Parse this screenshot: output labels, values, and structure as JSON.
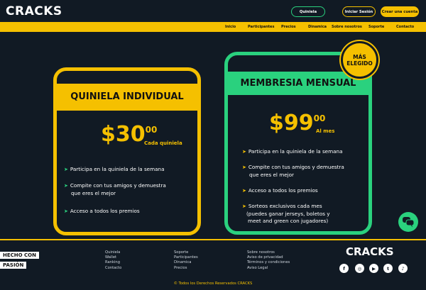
{
  "header": {
    "logo": "CRACKS",
    "buttons": {
      "quiniela": "Quiniela",
      "login": "Iniciar Sesión",
      "signup": "Crear una cuenta"
    },
    "nav": [
      "Inicio",
      "Participantes",
      "Precios",
      "Dinamica",
      "Sobre nosotros",
      "Soporte",
      "Contacto"
    ]
  },
  "plans": {
    "individual": {
      "title": "QUINIELA INDIVIDUAL",
      "price": "$30",
      "cents": "00",
      "period": "Cada quiniela",
      "features": [
        "Participa en la quiniela de la semana",
        "Compite con tus amigos y demuestra",
        "que eres el mejor",
        "Acceso a todos los premios"
      ]
    },
    "membership": {
      "badge_line1": "MÁS",
      "badge_line2": "ELEGIDO",
      "title": "MEMBRESIA MENSUAL",
      "price": "$99",
      "cents": "00",
      "period": "Al mes",
      "features": [
        "Participa en la quiniela de la semana",
        "Compite con tus amigos y demuestra",
        "que eres el mejor",
        "Acceso a todos los premios",
        "Sorteos exclusivos cada mes",
        "(puedes ganar jerseys, boletos y",
        "meet and green con jugadores)"
      ]
    }
  },
  "footer": {
    "hecho_line1": "HECHO CON",
    "hecho_line2": "PASIÓN",
    "col1": [
      "Quiniela",
      "Wallet",
      "Ranking",
      "Contacto"
    ],
    "col2": [
      "Soporte",
      "Participantes",
      "Dinamica",
      "Precios"
    ],
    "col3": [
      "Sobre nosotros",
      "Aviso de privacidad",
      "Términos y condiciones",
      "Aviso Legal"
    ],
    "logo": "CRACKS",
    "social": [
      "facebook-icon",
      "instagram-icon",
      "youtube-icon",
      "twitter-icon",
      "tiktok-icon"
    ],
    "copyright": "© Todos los Derechos Reservados CRACKS"
  },
  "colors": {
    "background": "#111a24",
    "yellow": "#f5c000",
    "green": "#2ad17e"
  }
}
